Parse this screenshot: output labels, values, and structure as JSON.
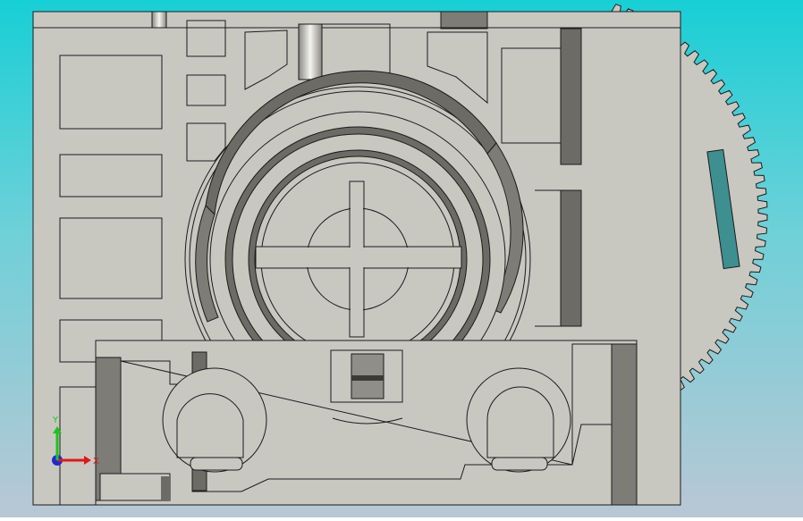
{
  "app": {
    "view": "cad-graphics-area-top-view"
  },
  "colors": {
    "background_top": "#18cfd6",
    "background_bottom": "#b9c7d5",
    "part_face": "#c9c8c0",
    "edge": "#1b1b1b",
    "shadow_face": "#6c6b66",
    "dark_face": "#7d7c76",
    "slot_teal": "#3d8f90",
    "axis_x": "#e01818",
    "axis_y": "#1cc41c",
    "axis_z": "#1b2ad8"
  },
  "triad": {
    "x_label": "X",
    "y_label": "Y"
  }
}
